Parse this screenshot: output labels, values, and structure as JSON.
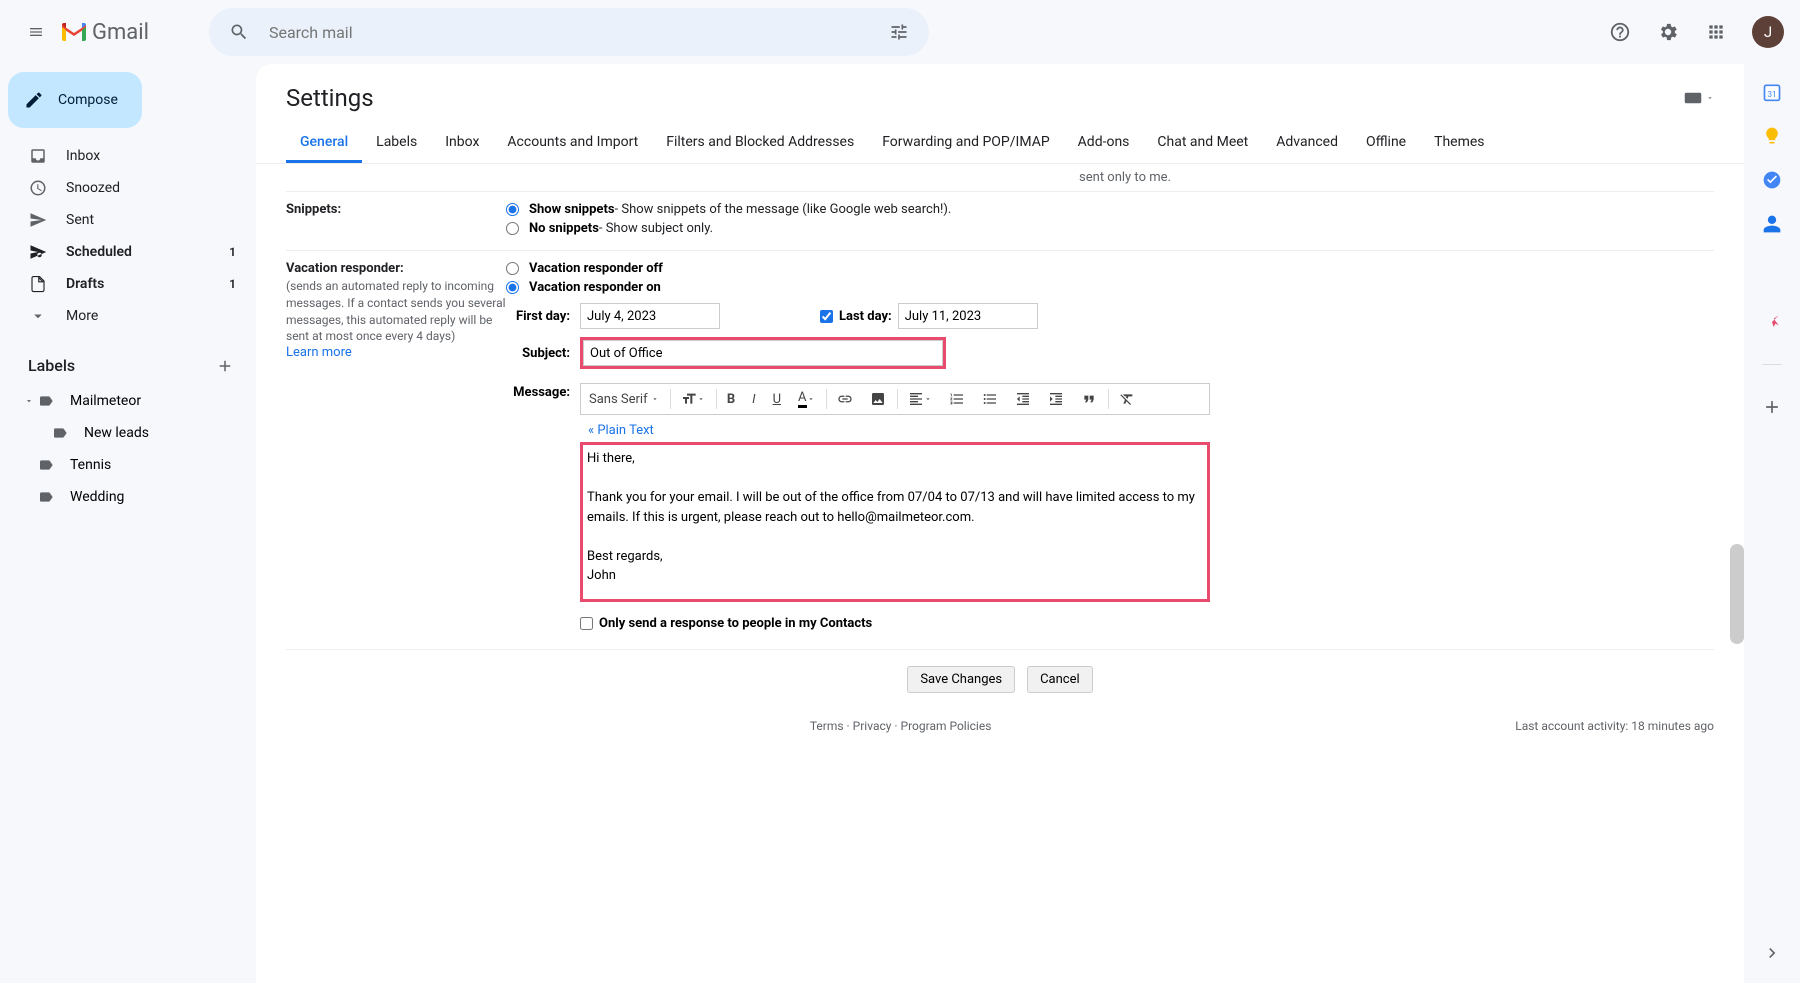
{
  "header": {
    "app_name": "Gmail",
    "search_placeholder": "Search mail",
    "avatar_initial": "J"
  },
  "sidebar": {
    "compose": "Compose",
    "items": [
      {
        "label": "Inbox",
        "count": ""
      },
      {
        "label": "Snoozed",
        "count": ""
      },
      {
        "label": "Sent",
        "count": ""
      },
      {
        "label": "Scheduled",
        "count": "1",
        "bold": true
      },
      {
        "label": "Drafts",
        "count": "1",
        "bold": true
      },
      {
        "label": "More",
        "count": ""
      }
    ],
    "labels_header": "Labels",
    "labels": [
      {
        "label": "Mailmeteor"
      },
      {
        "label": "New leads"
      },
      {
        "label": "Tennis"
      },
      {
        "label": "Wedding"
      }
    ]
  },
  "settings": {
    "title": "Settings",
    "tabs": [
      "General",
      "Labels",
      "Inbox",
      "Accounts and Import",
      "Filters and Blocked Addresses",
      "Forwarding and POP/IMAP",
      "Add-ons",
      "Chat and Meet",
      "Advanced",
      "Offline",
      "Themes"
    ],
    "cut_text": "sent only to me.",
    "snippets": {
      "title": "Snippets:",
      "show_bold": "Show snippets",
      "show_desc": " - Show snippets of the message (like Google web search!).",
      "no_bold": "No snippets",
      "no_desc": " - Show subject only."
    },
    "vacation": {
      "title": "Vacation responder:",
      "desc": "(sends an automated reply to incoming messages. If a contact sends you several messages, this automated reply will be sent at most once every 4 days)",
      "learn": "Learn more",
      "off_label": "Vacation responder off",
      "on_label": "Vacation responder on",
      "first_day_label": "First day:",
      "first_day_value": "July 4, 2023",
      "last_day_label": "Last day:",
      "last_day_value": "July 11, 2023",
      "subject_label": "Subject:",
      "subject_value": "Out of Office",
      "message_label": "Message:",
      "font_name": "Sans Serif",
      "plain_text": "« Plain Text",
      "message_body": "Hi there,\n\nThank you for your email. I will be out of the office from 07/04 to 07/13 and will have limited access to my emails. If this is urgent, please reach out to hello@mailmeteor.com.\n\nBest regards,\nJohn",
      "contacts_only": "Only send a response to people in my Contacts"
    },
    "save": "Save Changes",
    "cancel": "Cancel",
    "footer_links": "Terms · Privacy · Program Policies",
    "footer_activity": "Last account activity: 18 minutes ago"
  }
}
